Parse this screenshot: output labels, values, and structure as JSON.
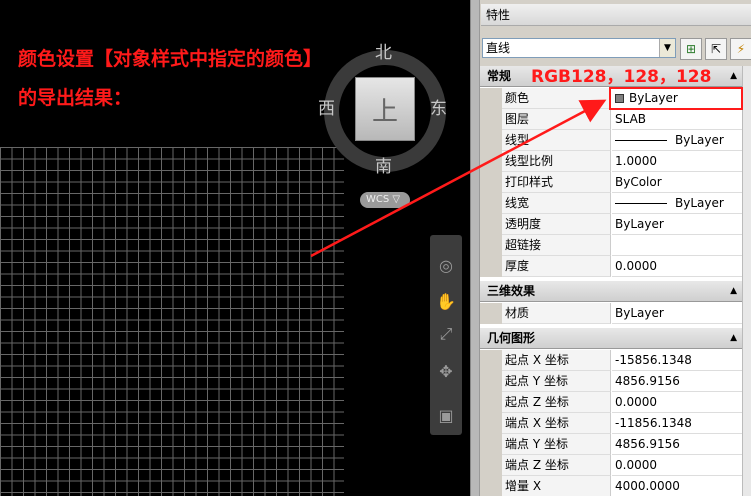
{
  "canvas": {
    "annotation": "颜色设置【对象样式中指定的颜色】\n的导出结果：",
    "viewcube": {
      "north": "北",
      "south": "南",
      "west": "西",
      "east": "东",
      "face": "上",
      "wcs": "WCS ▽"
    }
  },
  "palette": {
    "title": "特性",
    "object_type": "直线",
    "callout": "RGB128，128，128",
    "sections": {
      "general": {
        "title": "常规",
        "rows": [
          {
            "name": "颜色",
            "value": "ByLayer"
          },
          {
            "name": "图层",
            "value": "SLAB"
          },
          {
            "name": "线型",
            "value": "ByLayer"
          },
          {
            "name": "线型比例",
            "value": "1.0000"
          },
          {
            "name": "打印样式",
            "value": "ByColor"
          },
          {
            "name": "线宽",
            "value": "ByLayer"
          },
          {
            "name": "透明度",
            "value": "ByLayer"
          },
          {
            "name": "超链接",
            "value": ""
          },
          {
            "name": "厚度",
            "value": "0.0000"
          }
        ]
      },
      "effects3d": {
        "title": "三维效果",
        "rows": [
          {
            "name": "材质",
            "value": "ByLayer"
          }
        ]
      },
      "geometry": {
        "title": "几何图形",
        "rows": [
          {
            "name": "起点 X 坐标",
            "value": "-15856.1348"
          },
          {
            "name": "起点 Y 坐标",
            "value": "4856.9156"
          },
          {
            "name": "起点 Z 坐标",
            "value": "0.0000"
          },
          {
            "name": "端点 X 坐标",
            "value": "-11856.1348"
          },
          {
            "name": "端点 Y 坐标",
            "value": "4856.9156"
          },
          {
            "name": "端点 Z 坐标",
            "value": "0.0000"
          },
          {
            "name": "增量 X",
            "value": "4000.0000"
          }
        ]
      }
    }
  },
  "colors": {
    "annotation_red": "#ff1a1a",
    "swatch_gray": "#808080"
  }
}
